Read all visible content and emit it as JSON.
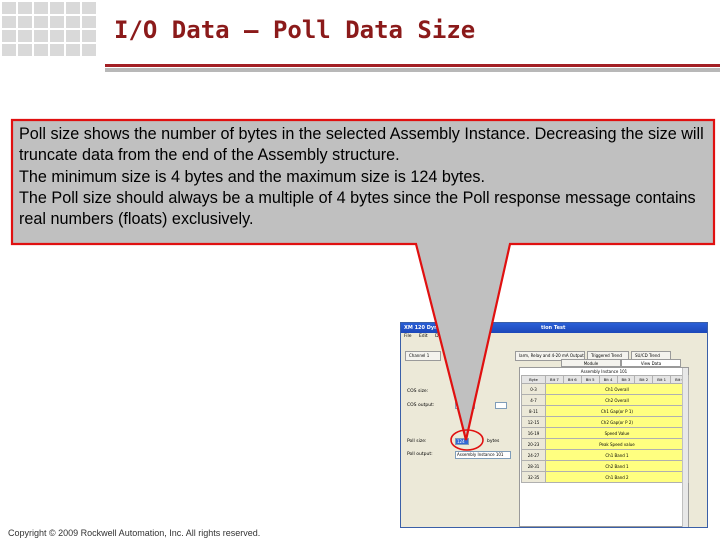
{
  "header": {
    "title": "I/O Data – Poll Data Size"
  },
  "callout": {
    "paragraphs": [
      "Poll size shows the number of bytes in the selected Assembly Instance.  Decreasing the size will truncate data from the end of the Assembly structure.",
      "The minimum size is 4 bytes and the maximum size is 124 bytes.",
      "The Poll size should always be a multiple of 4 bytes since the Poll response message contains real numbers (floats) exclusively."
    ]
  },
  "screenshot": {
    "window_title": "XM 120 Dyna...",
    "window_title_right": "tion Test",
    "menu": [
      "File",
      "Edit",
      "Devi..."
    ],
    "tabs": [
      "Channel 1",
      "",
      "larm, Relay and 4-20 mA Output",
      "Triggered Trend",
      "SU/CD Trend"
    ],
    "subtabs": [
      "Module",
      "View Data"
    ],
    "cos_size_label": "COS size:",
    "cos_output_label": "COS output:",
    "poll_size_label": "Poll size:",
    "poll_output_label": "Poll output:",
    "poll_size_value": "124",
    "poll_size_unit": "bytes",
    "poll_output_value": "Assembly Instance 101",
    "assembly_caption": "Assembly Instance 101",
    "columns": [
      "Byte",
      "Bit 7",
      "Bit 6",
      "Bit 5",
      "Bit 4",
      "Bit 3",
      "Bit 2",
      "Bit 1",
      "Bit 0"
    ],
    "rows": [
      {
        "byte": "0-3",
        "value": "Ch1 Overall"
      },
      {
        "byte": "4-7",
        "value": "Ch2 Overall"
      },
      {
        "byte": "8-11",
        "value": "Ch1 Gap(or P 1)"
      },
      {
        "byte": "12-15",
        "value": "Ch2 Gap(or P 2)"
      },
      {
        "byte": "16-19",
        "value": "Speed Value"
      },
      {
        "byte": "20-23",
        "value": "Peak Speed value"
      },
      {
        "byte": "24-27",
        "value": "Ch1 Band 1"
      },
      {
        "byte": "28-31",
        "value": "Ch2 Band 1"
      },
      {
        "byte": "32-35",
        "value": "Ch1 Band 2"
      }
    ]
  },
  "footer": {
    "copyright": "Copyright © 2009 Rockwell Automation, Inc. All rights reserved."
  },
  "colors": {
    "title": "#8b1a1a",
    "accent_red": "#a31f24",
    "callout_fill": "#c0c0c0",
    "callout_stroke": "#e01010",
    "highlight_cells": "#ffff80"
  }
}
